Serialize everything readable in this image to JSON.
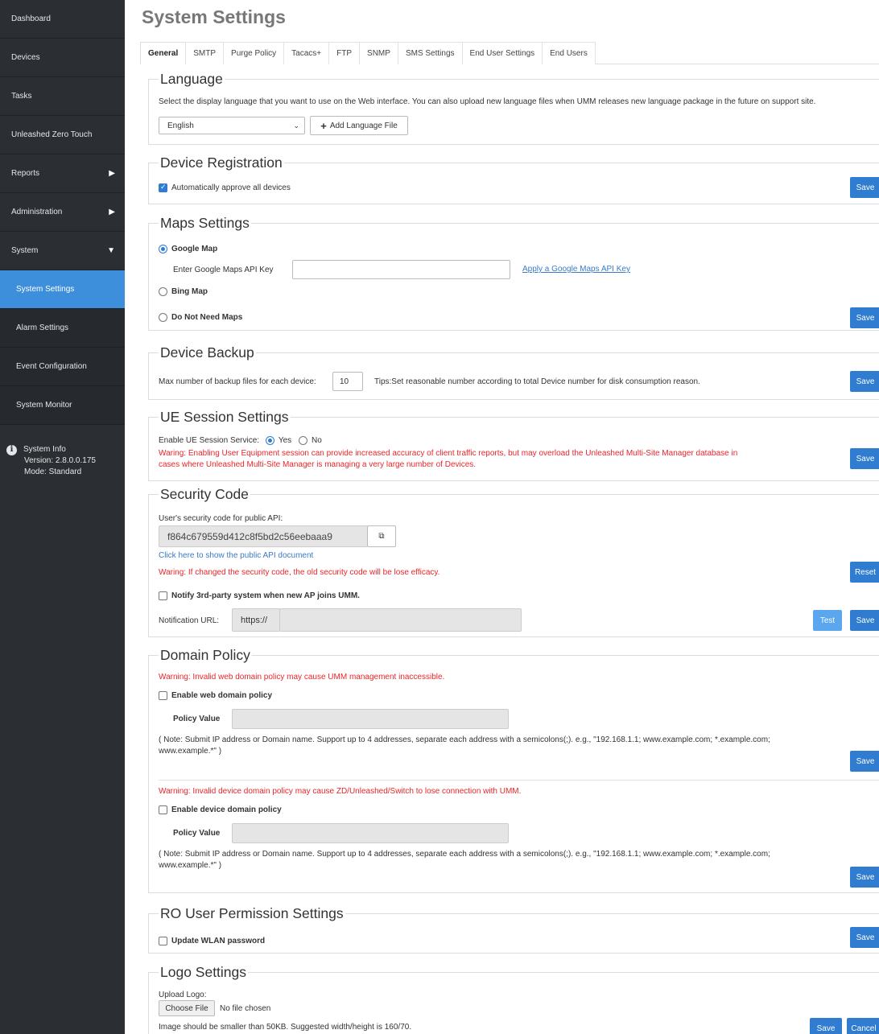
{
  "sidebar": {
    "items": [
      {
        "label": "Dashboard"
      },
      {
        "label": "Devices"
      },
      {
        "label": "Tasks"
      },
      {
        "label": "Unleashed Zero Touch"
      },
      {
        "label": "Reports",
        "arrow": "▶"
      },
      {
        "label": "Administration",
        "arrow": "▶"
      },
      {
        "label": "System",
        "arrow": "▼"
      }
    ],
    "subitems": [
      {
        "label": "System Settings"
      },
      {
        "label": "Alarm Settings"
      },
      {
        "label": "Event Configuration"
      },
      {
        "label": "System Monitor"
      }
    ],
    "system_info": {
      "title": "System Info",
      "version": "Version: 2.8.0.0.175",
      "mode": "Mode: Standard"
    }
  },
  "page": {
    "title": "System Settings"
  },
  "tabs": [
    "General",
    "SMTP",
    "Purge Policy",
    "Tacacs+",
    "FTP",
    "SNMP",
    "SMS Settings",
    "End User Settings",
    "End Users"
  ],
  "language": {
    "title": "Language",
    "description": "Select the display language that you want to use on the Web interface. You can also upload new language files when UMM releases new language package in the future on support site.",
    "selected": "English",
    "add_button": "Add Language File"
  },
  "device_registration": {
    "title": "Device Registration",
    "auto_approve": "Automatically approve all devices",
    "save": "Save"
  },
  "maps": {
    "title": "Maps Settings",
    "google": "Google Map",
    "api_key_label": "Enter Google Maps API Key",
    "api_key_link": "Apply a Google Maps API Key",
    "bing": "Bing Map",
    "none": "Do Not Need Maps",
    "save": "Save"
  },
  "backup": {
    "title": "Device Backup",
    "label": "Max number of backup files for each device:",
    "value": "10",
    "tips": "Tips:Set reasonable number according to total Device number for disk consumption reason.",
    "save": "Save"
  },
  "ue_session": {
    "title": "UE Session Settings",
    "label": "Enable UE Session Service:",
    "yes": "Yes",
    "no": "No",
    "warning1": "Waring: Enabling User Equipment session can provide increased accuracy of client traffic reports, but may overload the Unleashed Multi-Site Manager database in",
    "warning2": "cases where Unleashed Multi-Site Manager is managing a very large number of Devices.",
    "save": "Save"
  },
  "security": {
    "title": "Security Code",
    "label": "User's security code for public API:",
    "code": "f864c679559d412c8f5bd2c56eebaaa9",
    "doc_link": "Click here to show the public API document",
    "warning": "Waring: If changed the security code, the old security code will be lose efficacy.",
    "reset": "Reset",
    "notify": "Notify 3rd-party system when new AP joins UMM.",
    "url_label": "Notification URL:",
    "url_prefix": "https://",
    "test": "Test",
    "save": "Save"
  },
  "domain": {
    "title": "Domain Policy",
    "warning_web": "Warning: Invalid web domain policy may cause UMM management inaccessible.",
    "enable_web": "Enable web domain policy",
    "policy_value": "Policy Value",
    "note1": "( Note: Submit IP address or Domain name. Support up to 4 addresses, separate each address with a semicolons(;). e.g., \"192.168.1.1; www.example.com; *.example.com;",
    "note2": "www.example.*\" )",
    "warning_device": "Warning: Invalid device domain policy may cause ZD/Unleashed/Switch to lose connection with UMM.",
    "enable_device": "Enable device domain policy",
    "save": "Save"
  },
  "ro_user": {
    "title": "RO User Permission Settings",
    "update_wlan": "Update WLAN password",
    "save": "Save"
  },
  "logo": {
    "title": "Logo Settings",
    "upload_label": "Upload Logo:",
    "choose": "Choose File",
    "no_file": "No file chosen",
    "hint": "Image should be smaller than 50KB. Suggested width/height is 160/70.",
    "save": "Save",
    "cancel": "Cancel"
  },
  "colors": {
    "accent": "#2f7cd0",
    "sidebar": "#2b2e33",
    "active_nav": "#3d8fdc",
    "warning": "#e8262b"
  }
}
